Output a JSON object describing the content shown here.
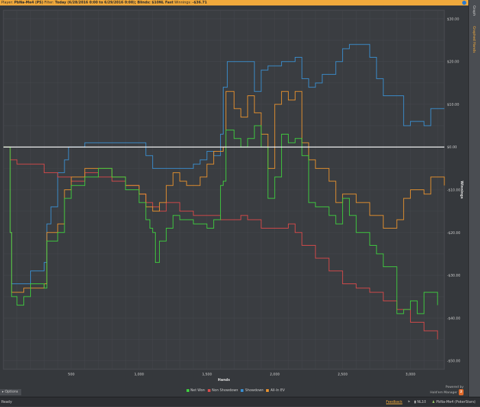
{
  "header": {
    "player_label": "Player:",
    "player": "PbNa-Me4 (PS)",
    "filter_label": "Filter:",
    "filter": "Today (6/28/2016 0:00 to 6/29/2016 0:00); Blinds: $10NL Fast",
    "winnings_label": "Winnings:",
    "winnings": "-$36.71"
  },
  "side_tabs": [
    "Graph",
    "Graphed Hands"
  ],
  "options_label": "Options",
  "brand": {
    "powered": "Powered by",
    "name": "Hold'em Manager",
    "logo": "2"
  },
  "status": {
    "ready": "Ready",
    "feedback": "Feedback",
    "stake": "NL10",
    "player": "PbNa-Me4 (PokerStars)"
  },
  "colors": {
    "net_won": "#3fcf3f",
    "non_showdown": "#d84a4a",
    "showdown": "#3a8fd0",
    "all_in_ev": "#e8922e",
    "zero": "#ffffff"
  },
  "chart_data": {
    "type": "line",
    "xlabel": "Hands",
    "ylabel": "Winnings",
    "xlim": [
      0,
      3250
    ],
    "ylim": [
      -52,
      32
    ],
    "xticks": [
      500,
      1000,
      1500,
      2000,
      2500,
      3000
    ],
    "xtick_labels": [
      "500",
      "1,000",
      "1,500",
      "2,000",
      "2,500",
      "3,000"
    ],
    "yticks": [
      30,
      20,
      10,
      0,
      -10,
      -20,
      -30,
      -40,
      -50
    ],
    "ytick_labels": [
      "$30.00",
      "$20.00",
      "$10.00",
      "$0.00",
      "-$10.00",
      "-$20.00",
      "-$30.00",
      "-$40.00",
      "-$50.00"
    ],
    "grid": true,
    "legend": "bottom",
    "series": [
      {
        "name": "Net Won",
        "key": "net_won",
        "x": [
          0,
          30,
          50,
          60,
          100,
          150,
          200,
          300,
          320,
          400,
          450,
          500,
          600,
          700,
          800,
          900,
          1000,
          1050,
          1080,
          1100,
          1120,
          1150,
          1200,
          1250,
          1300,
          1400,
          1500,
          1550,
          1600,
          1620,
          1640,
          1700,
          1750,
          1800,
          1850,
          1900,
          1950,
          2000,
          2050,
          2100,
          2150,
          2200,
          2250,
          2300,
          2400,
          2450,
          2500,
          2550,
          2600,
          2700,
          2750,
          2800,
          2900,
          2950,
          3000,
          3050,
          3100,
          3200
        ],
        "y": [
          0,
          0,
          -20,
          -35,
          -37,
          -35,
          -32,
          -33,
          -22,
          -20,
          -12,
          -9,
          -7,
          -5,
          -7,
          -10,
          -13,
          -17,
          -19,
          -20,
          -27,
          -22,
          -19,
          -16,
          -17,
          -18,
          -19,
          -17,
          -9,
          -8,
          4,
          2,
          0,
          2,
          5,
          0,
          -12,
          -7,
          3,
          1,
          2,
          -2,
          -13,
          -14,
          -16,
          -18,
          -12,
          -16,
          -20,
          -23,
          -25,
          -28,
          -39,
          -38,
          -36,
          -39,
          -34,
          -37
        ]
      },
      {
        "name": "Non Showdown",
        "key": "non_showdown",
        "x": [
          0,
          50,
          100,
          200,
          300,
          400,
          500,
          600,
          700,
          800,
          900,
          1000,
          1050,
          1100,
          1150,
          1200,
          1300,
          1400,
          1500,
          1600,
          1700,
          1750,
          1800,
          1900,
          2000,
          2100,
          2150,
          2200,
          2300,
          2400,
          2500,
          2600,
          2700,
          2800,
          2900,
          3000,
          3100,
          3200
        ],
        "y": [
          0,
          -3,
          -4,
          -4,
          -6,
          -7,
          -8,
          -6,
          -7,
          -8,
          -9,
          -11,
          -13,
          -14,
          -15,
          -13,
          -15,
          -16,
          -16,
          -17,
          -17,
          -16,
          -17,
          -19,
          -19,
          -18,
          -20,
          -23,
          -26,
          -29,
          -32,
          -33,
          -34,
          -36,
          -38,
          -41,
          -43,
          -45
        ]
      },
      {
        "name": "Showdown",
        "key": "showdown",
        "x": [
          0,
          50,
          60,
          150,
          200,
          300,
          320,
          350,
          400,
          450,
          480,
          600,
          700,
          800,
          900,
          1000,
          1050,
          1100,
          1300,
          1400,
          1450,
          1500,
          1550,
          1600,
          1620,
          1650,
          1800,
          1850,
          1900,
          1950,
          2050,
          2150,
          2200,
          2250,
          2300,
          2350,
          2450,
          2500,
          2550,
          2700,
          2750,
          2800,
          2950,
          3000,
          3100,
          3150,
          3250
        ],
        "y": [
          0,
          -20,
          -32,
          -32,
          -29,
          -27,
          -18,
          -14,
          -6,
          -3,
          0,
          1,
          1,
          1,
          1,
          1,
          -2,
          -5,
          -5,
          -4,
          -3,
          -1,
          -2,
          3,
          14,
          20,
          20,
          13,
          18,
          19,
          20,
          21,
          16,
          14,
          15,
          17,
          20,
          23,
          24,
          21,
          16,
          12,
          5,
          6,
          5,
          9,
          9
        ]
      },
      {
        "name": "All-In EV",
        "key": "all_in_ev",
        "x": [
          0,
          50,
          60,
          150,
          300,
          320,
          400,
          450,
          500,
          600,
          800,
          900,
          1000,
          1050,
          1100,
          1150,
          1200,
          1250,
          1300,
          1350,
          1450,
          1500,
          1550,
          1620,
          1640,
          1700,
          1750,
          1800,
          1850,
          1900,
          1950,
          2000,
          2050,
          2100,
          2150,
          2200,
          2250,
          2300,
          2400,
          2450,
          2500,
          2600,
          2700,
          2800,
          2900,
          2950,
          3000,
          3100,
          3150,
          3250
        ],
        "y": [
          0,
          -20,
          -34,
          -33,
          -32,
          -20,
          -18,
          -10,
          -7,
          -5,
          -7,
          -9,
          -11,
          -14,
          -15,
          -13,
          -9,
          -6,
          -8,
          -9,
          -7,
          -4,
          -1,
          0,
          13,
          9,
          7,
          12,
          8,
          3,
          -5,
          10,
          13,
          11,
          13,
          1,
          -3,
          -5,
          -8,
          -13,
          -11,
          -13,
          -16,
          -19,
          -17,
          -12,
          -10,
          -11,
          -7,
          -9
        ]
      }
    ]
  }
}
